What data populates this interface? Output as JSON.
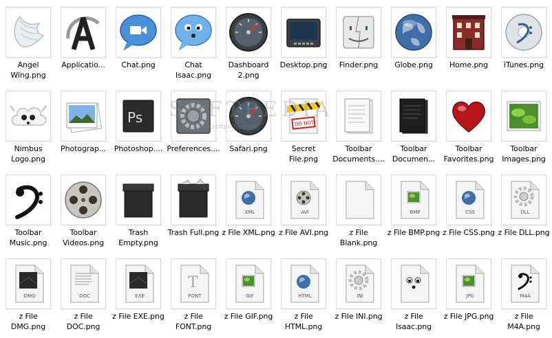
{
  "files": [
    {
      "label": "Angel Wing.png",
      "icon": "angel-wing-icon",
      "kind": "wing"
    },
    {
      "label": "Applicatio...",
      "icon": "applications-icon",
      "kind": "apps"
    },
    {
      "label": "Chat.png",
      "icon": "chat-bubble-icon",
      "kind": "chat"
    },
    {
      "label": "Chat Isaac.png",
      "icon": "chat-isaac-icon",
      "kind": "chatface"
    },
    {
      "label": "Dashboard 2.png",
      "icon": "dashboard-gauge-icon",
      "kind": "gauge"
    },
    {
      "label": "Desktop.png",
      "icon": "desktop-icon",
      "kind": "desktop"
    },
    {
      "label": "Finder.png",
      "icon": "finder-icon",
      "kind": "finder"
    },
    {
      "label": "Globe.png",
      "icon": "globe-icon",
      "kind": "globe"
    },
    {
      "label": "Home.png",
      "icon": "home-icon",
      "kind": "home"
    },
    {
      "label": "iTunes.png",
      "icon": "itunes-icon",
      "kind": "itunes"
    },
    {
      "label": "Nimbus Logo.png",
      "icon": "nimbus-cloud-icon",
      "kind": "cloud"
    },
    {
      "label": "Photograp...",
      "icon": "photographs-icon",
      "kind": "photo"
    },
    {
      "label": "Photoshop....",
      "icon": "photoshop-icon",
      "kind": "ps"
    },
    {
      "label": "Preferences....",
      "icon": "preferences-gear-icon",
      "kind": "prefs"
    },
    {
      "label": "Safari.png",
      "icon": "safari-compass-icon",
      "kind": "gauge"
    },
    {
      "label": "Secret File.png",
      "icon": "secret-file-icon",
      "kind": "secret"
    },
    {
      "label": "Toolbar Documents....",
      "icon": "documents-icon",
      "kind": "docs"
    },
    {
      "label": "Toolbar Documen...",
      "icon": "documents-dark-icon",
      "kind": "docsdark"
    },
    {
      "label": "Toolbar Favorites.png",
      "icon": "heart-icon",
      "kind": "heart"
    },
    {
      "label": "Toolbar Images.png",
      "icon": "images-icon",
      "kind": "images"
    },
    {
      "label": "Toolbar Music.png",
      "icon": "bass-clef-icon",
      "kind": "clef"
    },
    {
      "label": "Toolbar Videos.png",
      "icon": "film-reel-icon",
      "kind": "reel"
    },
    {
      "label": "Trash Empty.png",
      "icon": "trash-empty-icon",
      "kind": "trash"
    },
    {
      "label": "Trash Full.png",
      "icon": "trash-full-icon",
      "kind": "trashfull"
    },
    {
      "label": "z File XML.png",
      "icon": "xml-file-icon",
      "kind": "file",
      "ext": "XML",
      "badge": "globe"
    },
    {
      "label": "z File AVI.png",
      "icon": "avi-file-icon",
      "kind": "file",
      "ext": "AVI",
      "badge": "reel"
    },
    {
      "label": "z File Blank.png",
      "icon": "blank-file-icon",
      "kind": "file",
      "ext": "",
      "badge": ""
    },
    {
      "label": "z File BMP.png",
      "icon": "bmp-file-icon",
      "kind": "file",
      "ext": "BMP",
      "badge": "img"
    },
    {
      "label": "z File CSS.png",
      "icon": "css-file-icon",
      "kind": "file",
      "ext": "CSS",
      "badge": "globe"
    },
    {
      "label": "z File DLL.png",
      "icon": "dll-file-icon",
      "kind": "file",
      "ext": "DLL",
      "badge": "gear"
    },
    {
      "label": "z File DMG.png",
      "icon": "dmg-file-icon",
      "kind": "file",
      "ext": "DMG",
      "badge": "drive"
    },
    {
      "label": "z File DOC.png",
      "icon": "doc-file-icon",
      "kind": "file",
      "ext": "DOC",
      "badge": "text"
    },
    {
      "label": "z File EXE.png",
      "icon": "exe-file-icon",
      "kind": "file",
      "ext": "EXE",
      "badge": "drive"
    },
    {
      "label": "z File FONT.png",
      "icon": "font-file-icon",
      "kind": "file",
      "ext": "FONT",
      "badge": "T"
    },
    {
      "label": "z File GIF.png",
      "icon": "gif-file-icon",
      "kind": "file",
      "ext": "GIF",
      "badge": "img"
    },
    {
      "label": "z File HTML.png",
      "icon": "html-file-icon",
      "kind": "file",
      "ext": "HTML",
      "badge": "globe"
    },
    {
      "label": "z File INI.png",
      "icon": "ini-file-icon",
      "kind": "file",
      "ext": "INI",
      "badge": "gear"
    },
    {
      "label": "z File Isaac.png",
      "icon": "isaac-file-icon",
      "kind": "file",
      "ext": "",
      "badge": "face"
    },
    {
      "label": "z File JPG.png",
      "icon": "jpg-file-icon",
      "kind": "file",
      "ext": "JPG",
      "badge": "img"
    },
    {
      "label": "z File M4A.png",
      "icon": "m4a-file-icon",
      "kind": "file",
      "ext": "M4A",
      "badge": "clef"
    }
  ],
  "watermark": {
    "main": "SOFTPEDIA",
    "sub": "www.softpedia.com"
  }
}
